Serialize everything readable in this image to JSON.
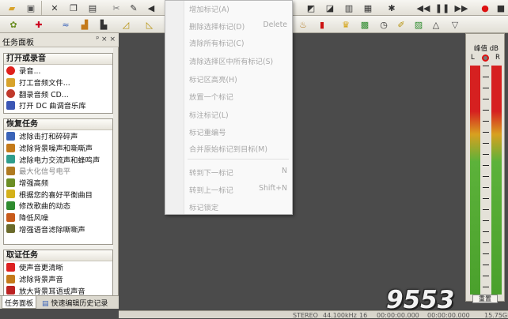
{
  "taskpane": {
    "title": "任务面板",
    "controls": "ᵖ × ×",
    "sections": [
      {
        "title": "打开或录音",
        "items": [
          {
            "label": "录音...",
            "icon": "record-icon",
            "color": "#e0201b"
          },
          {
            "label": "打工音频文件...",
            "icon": "open-folder-icon",
            "color": "#d8a32b"
          },
          {
            "label": "翻录音频 CD...",
            "icon": "cd-icon",
            "color": "#c0392b"
          },
          {
            "label": "打开 DC 曲调音乐库",
            "icon": "music-library-icon",
            "color": "#3b56b5"
          }
        ]
      },
      {
        "title": "恢复任务",
        "items": [
          {
            "label": "滤除击打和碎碎声",
            "icon": "click-filter-icon",
            "color": "#3a63b8"
          },
          {
            "label": "滤除背景噪声和嘶嘶声",
            "icon": "noise-filter-icon",
            "color": "#c47a1a"
          },
          {
            "label": "滤除电力交流声和蜂鸣声",
            "icon": "hum-filter-icon",
            "color": "#2f9d8c"
          },
          {
            "label": "最大化信号电平",
            "icon": "maximize-icon",
            "color": "#b07a20",
            "disabled": true
          },
          {
            "label": "增强高频",
            "icon": "treble-icon",
            "color": "#6b8e23"
          },
          {
            "label": "根据您的喜好平衡曲目",
            "icon": "balance-icon",
            "color": "#d4b11a"
          },
          {
            "label": "修改歌曲的动态",
            "icon": "dynamics-icon",
            "color": "#2e8b2e"
          },
          {
            "label": "降低风噪",
            "icon": "wind-icon",
            "color": "#c85a1a"
          },
          {
            "label": "增强语音滤除嘶嘶声",
            "icon": "voice-icon",
            "color": "#6a6a2a"
          }
        ]
      },
      {
        "title": "取证任务",
        "items": [
          {
            "label": "使声音更清晰",
            "icon": "lips-icon",
            "color": "#d22"
          },
          {
            "label": "滤除背景声音",
            "icon": "filter-bg-icon",
            "color": "#c47a1a"
          },
          {
            "label": "放大背景耳语或声音",
            "icon": "amplify-icon",
            "color": "#b22"
          }
        ]
      }
    ],
    "tabs": [
      {
        "label": "任务面板",
        "active": true
      },
      {
        "label": "快速编辑历史记录",
        "active": false
      }
    ]
  },
  "context_menu": {
    "items": [
      {
        "label": "增加标记(A)",
        "shortcut": ""
      },
      {
        "label": "删除选择标记(D)",
        "shortcut": "Delete"
      },
      {
        "label": "清除所有标记(C)",
        "shortcut": ""
      },
      {
        "label": "清除选择区中所有标记(S)",
        "shortcut": ""
      },
      {
        "label": "标记区高亮(H)",
        "shortcut": ""
      },
      {
        "label": "放置一个标记",
        "shortcut": ""
      },
      {
        "label": "标注标记(L)",
        "shortcut": ""
      },
      {
        "label": "标记重编号",
        "shortcut": ""
      },
      {
        "label": "合并原始标记到目标(M)",
        "shortcut": ""
      },
      {
        "label": "转到下一标记",
        "shortcut": "N"
      },
      {
        "label": "转到上一标记",
        "shortcut": "Shift+N"
      },
      {
        "label": "标记锁定",
        "shortcut": ""
      }
    ]
  },
  "meter": {
    "title": "峰值 dB",
    "left": "L",
    "right": "R",
    "reset": "重置"
  },
  "status": {
    "mode": "STEREO",
    "rate": "44.100kHz",
    "bits": "16",
    "time1": "00:00:00.000",
    "time2": "00:00:00.000",
    "disk": "15.75GB"
  },
  "watermark": "9553"
}
